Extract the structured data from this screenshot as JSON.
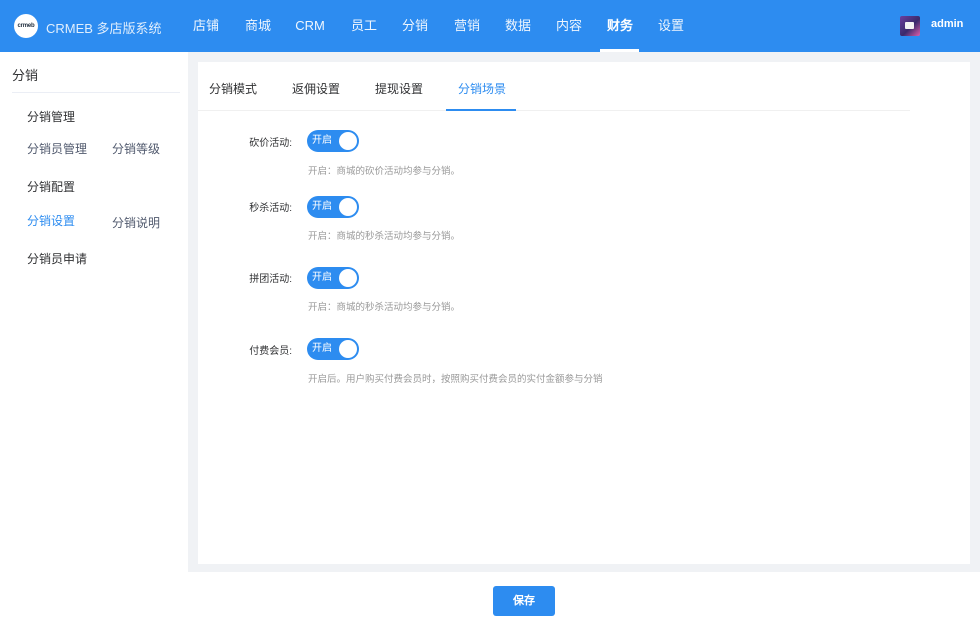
{
  "header": {
    "logo_text": "crmeb",
    "brand": "CRMEB 多店版系统",
    "nav": [
      "店铺",
      "商城",
      "CRM",
      "员工",
      "分销",
      "营销",
      "数据",
      "内容",
      "财务",
      "设置"
    ],
    "active_nav": "财务",
    "user": "admin"
  },
  "sidebar": {
    "title": "分销",
    "group1": "分销管理",
    "link_members": "分销员管理",
    "link_levels": "分销等级",
    "group2": "分销配置",
    "link_settings": "分销设置",
    "link_desc": "分销说明",
    "group3": "分销员申请"
  },
  "tabs": [
    "分销模式",
    "返佣设置",
    "提现设置",
    "分销场景"
  ],
  "active_tab": "分销场景",
  "fields": [
    {
      "label": "砍价活动:",
      "toggle": "开启",
      "on": true,
      "help": "开启：商城的砍价活动均参与分销。"
    },
    {
      "label": "秒杀活动:",
      "toggle": "开启",
      "on": true,
      "help": "开启：商城的秒杀活动均参与分销。"
    },
    {
      "label": "拼团活动:",
      "toggle": "开启",
      "on": true,
      "help": "开启：商城的秒杀活动均参与分销。"
    },
    {
      "label": "付费会员:",
      "toggle": "开启",
      "on": true,
      "help": "开启后。用户购买付费会员时，按照购买付费会员的实付金额参与分销"
    }
  ],
  "save_label": "保存",
  "colors": {
    "primary": "#2d8cf0"
  }
}
